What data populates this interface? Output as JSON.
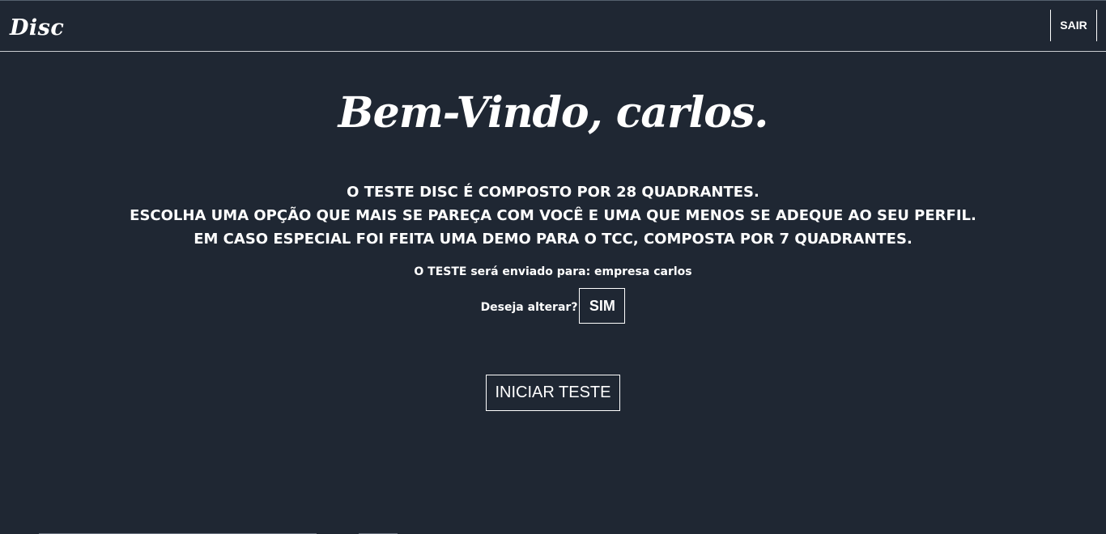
{
  "navbar": {
    "brand": "Disc",
    "logout_label": "SAIR"
  },
  "main": {
    "welcome": "Bem-Vindo, carlos.",
    "intro_lines": [
      "O TESTE DISC É COMPOSTO POR 28 QUADRANTES.",
      "ESCOLHA UMA OPÇÃO QUE MAIS SE PAREÇA COM VOCÊ E UMA QUE MENOS SE ADEQUE AO SEU PERFIL.",
      "EM CASO ESPECIAL FOI FEITA UMA DEMO PARA O TCC, COMPOSTA POR 7 QUADRANTES."
    ],
    "send_to": "O TESTE será enviado para: empresa carlos",
    "change_question": "Deseja alterar?",
    "change_button": "SIM",
    "start_button": "INICIAR TESTE"
  },
  "colors": {
    "background": "#1f2733",
    "text": "#ffffff",
    "divider": "#c9ccd1"
  }
}
